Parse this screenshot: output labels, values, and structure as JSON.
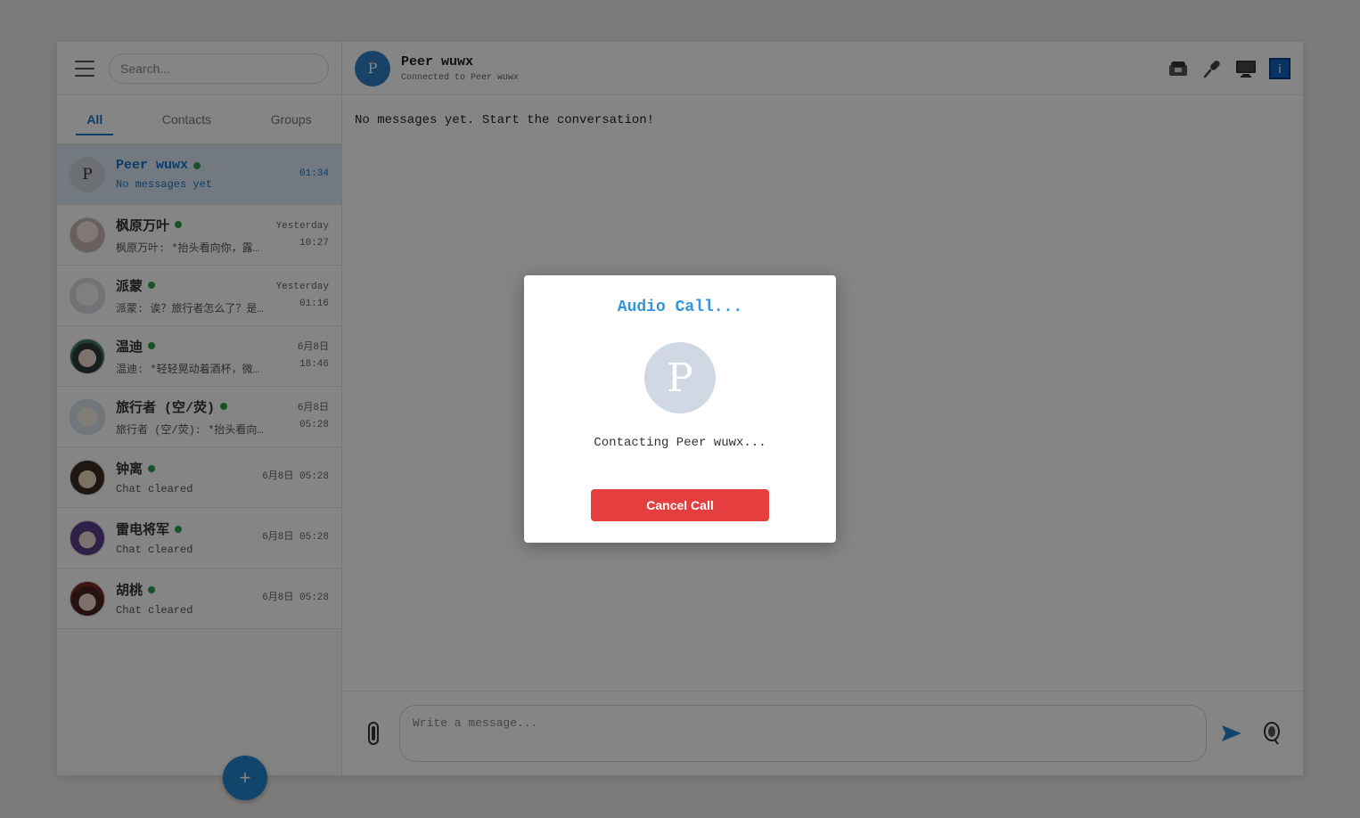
{
  "sidebar": {
    "search_placeholder": "Search...",
    "tabs": [
      {
        "label": "All",
        "active": true
      },
      {
        "label": "Contacts",
        "active": false
      },
      {
        "label": "Groups",
        "active": false
      }
    ],
    "chats": [
      {
        "name": "Peer wuwx",
        "preview": "No messages yet",
        "time": "01:34",
        "online": true,
        "active": true,
        "avatar_letter": "P"
      },
      {
        "name": "枫原万叶",
        "preview": "枫原万叶: *抬头看向你，露…",
        "time": "Yesterday\n10:27",
        "online": true
      },
      {
        "name": "派蒙",
        "preview": "派蒙: 诶？旅行者怎么了？是…",
        "time": "Yesterday\n01:16",
        "online": true
      },
      {
        "name": "温迪",
        "preview": "温迪: *轻轻晃动着酒杯，微…",
        "time": "6月8日\n18:46",
        "online": true
      },
      {
        "name": "旅行者 (空/荧)",
        "preview": "旅行者 (空/荧): *抬头看向…",
        "time": "6月8日\n05:28",
        "online": true
      },
      {
        "name": "钟离",
        "preview": "Chat cleared",
        "time": "6月8日 05:28",
        "online": true
      },
      {
        "name": "雷电将军",
        "preview": "Chat cleared",
        "time": "6月8日 05:28",
        "online": true
      },
      {
        "name": "胡桃",
        "preview": "Chat cleared",
        "time": "6月8日 05:28",
        "online": true
      }
    ],
    "fab_label": "+"
  },
  "header": {
    "avatar_letter": "P",
    "name": "Peer wuwx",
    "status": "Connected to Peer wuwx",
    "info_label": "i"
  },
  "messages": {
    "empty_text": "No messages yet. Start the conversation!"
  },
  "composer": {
    "placeholder": "Write a message..."
  },
  "modal": {
    "title": "Audio Call...",
    "avatar_letter": "P",
    "status": "Contacting Peer wuwx...",
    "cancel_label": "Cancel Call"
  },
  "colors": {
    "accent": "#2185d0",
    "online": "#2e9d47",
    "cancel": "#e53e3e",
    "modal_title": "#2f95dc"
  }
}
